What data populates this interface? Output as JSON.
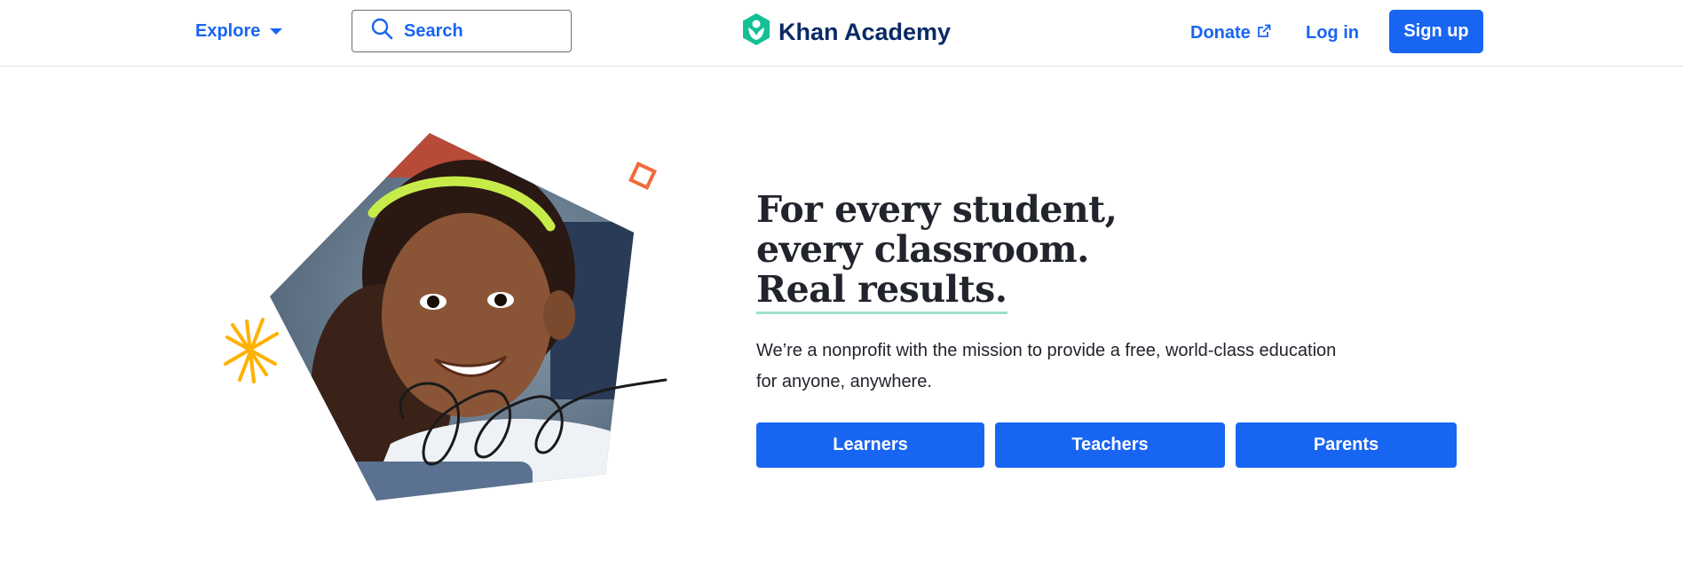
{
  "header": {
    "explore_label": "Explore",
    "search_placeholder": "Search",
    "logo_text": "Khan Academy",
    "donate_label": "Donate",
    "login_label": "Log in",
    "signup_label": "Sign up"
  },
  "hero": {
    "headline_lines": [
      "For every student,",
      "every classroom.",
      "Real results."
    ],
    "subtitle": "We’re a nonprofit with the mission to provide a free, world-class education for anyone, anywhere.",
    "buttons": [
      "Learners",
      "Teachers",
      "Parents"
    ]
  },
  "colors": {
    "brand_blue": "#1865f2",
    "logo_navy": "#0a2a66",
    "logo_green": "#14bf96",
    "accent_orange": "#f26b3a",
    "accent_yellow": "#ffb100",
    "headline_underline": "#9ee0cf"
  },
  "icons": [
    "chevron-down-icon",
    "search-icon",
    "khan-logo-icon",
    "external-link-icon",
    "star-burst-icon",
    "diamond-icon",
    "scribble-icon"
  ]
}
